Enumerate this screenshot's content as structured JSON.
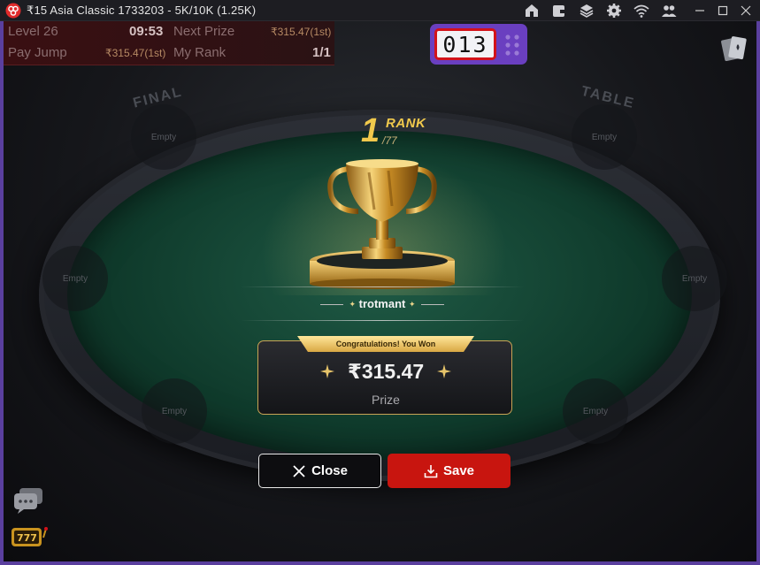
{
  "window": {
    "title": "₹15 Asia Classic 1733203 - 5K/10K (1.25K)",
    "toolbar_icons": [
      "lobby-icon",
      "wallet-icon",
      "layers-icon",
      "settings-icon",
      "wifi-icon",
      "players-icon"
    ]
  },
  "hud": {
    "level_label": "Level 26",
    "level_time": "09:53",
    "next_prize_label": "Next Prize",
    "next_prize_value": "₹315.47(1st)",
    "pay_jump_label": "Pay Jump",
    "pay_jump_value": "₹315.47(1st)",
    "my_rank_label": "My Rank",
    "my_rank_value": "1/1"
  },
  "timer": {
    "value": "013"
  },
  "table": {
    "rail_left": "FINAL",
    "rail_right": "TABLE",
    "seats": [
      "Empty",
      "Empty",
      "Empty",
      "Empty",
      "Empty",
      "Empty"
    ]
  },
  "result": {
    "rank_number": "1",
    "rank_word": "RANK",
    "rank_total": "/77",
    "player_name": "trotmant",
    "ribbon_text": "Congratulations! You Won",
    "prize_amount": "₹315.47",
    "prize_label": "Prize"
  },
  "buttons": {
    "close_label": "Close",
    "save_label": "Save"
  },
  "colors": {
    "accent_gold": "#f1c94c",
    "save_red": "#c8150f",
    "frame_purple": "#5a3f9e",
    "timer_purple": "#6a3fc0"
  }
}
